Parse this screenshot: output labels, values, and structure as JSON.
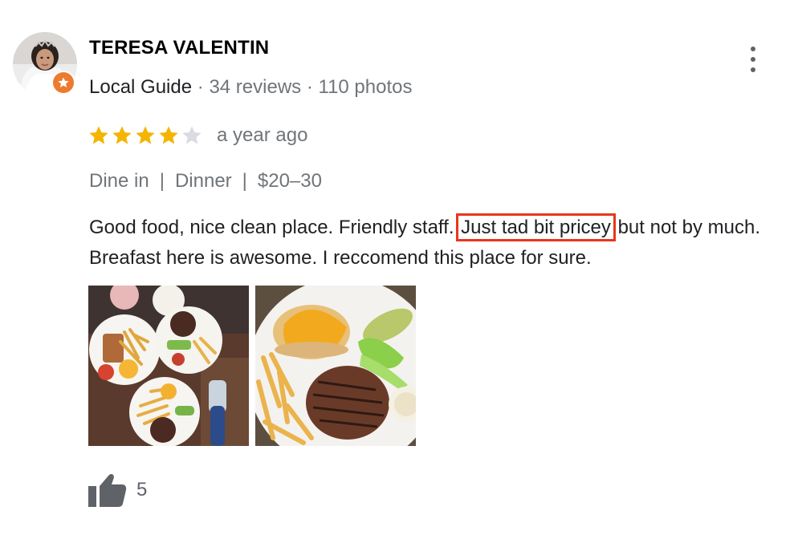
{
  "reviewer": {
    "name": "TERESA VALENTIN",
    "guide_label": "Local Guide",
    "separator": "·",
    "reviews": "34 reviews",
    "photos": "110 photos",
    "badge_color": "#ec7b2f"
  },
  "review": {
    "rating": 4,
    "rating_max": 5,
    "star_color": "#f4b400",
    "star_empty_color": "#dadce0",
    "date": "a year ago",
    "visit": {
      "service": "Dine in",
      "meal": "Dinner",
      "price": "$20–30",
      "separator": "|"
    },
    "text_before": "Good food, nice clean place. Friendly staff. ",
    "text_highlight": "Just tad bit pricey",
    "text_after": " but not by much. Breafast here is awesome. I reccomend this place for sure.",
    "highlight_color": "#e8361c"
  },
  "photos": [
    {
      "icon": "food-photo-plates"
    },
    {
      "icon": "food-photo-burger"
    }
  ],
  "actions": {
    "like_icon": "thumbs-up-icon",
    "like_count": "5",
    "more_icon": "more-vertical-icon"
  }
}
